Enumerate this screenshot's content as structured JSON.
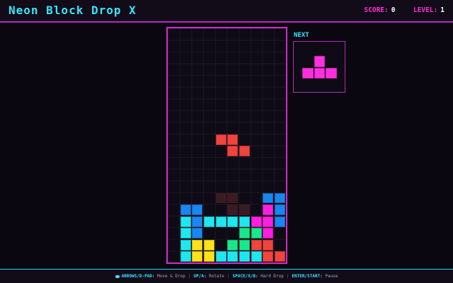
{
  "header": {
    "title": "Neon Block Drop X",
    "title_color": "#35e6ff",
    "score_label": "SCORE:",
    "score": "0",
    "level_label": "LEVEL:",
    "level": "1"
  },
  "next": {
    "label": "NEXT",
    "piece": "T",
    "color": "#ff2fe0",
    "cells": [
      [
        1,
        0
      ],
      [
        0,
        1
      ],
      [
        1,
        1
      ],
      [
        2,
        1
      ]
    ]
  },
  "board": {
    "cols": 10,
    "rows": 20,
    "colors": {
      "blue": "#1a86f0",
      "cyan": "#1fe7f0",
      "magenta": "#ff1fde",
      "green": "#19e88a",
      "yellow": "#ffe21a",
      "red": "#f0443f",
      "ghost": "#3b1b22"
    },
    "active_piece": {
      "type": "Z",
      "color": "red",
      "cells": [
        [
          4,
          9
        ],
        [
          5,
          9
        ],
        [
          5,
          10
        ],
        [
          6,
          10
        ]
      ]
    },
    "ghost_piece": {
      "cells": [
        [
          4,
          14
        ],
        [
          5,
          14
        ],
        [
          5,
          15
        ],
        [
          6,
          15
        ]
      ]
    },
    "locked": [
      {
        "c": 8,
        "r": 14,
        "color": "blue"
      },
      {
        "c": 9,
        "r": 14,
        "color": "blue"
      },
      {
        "c": 1,
        "r": 15,
        "color": "blue"
      },
      {
        "c": 2,
        "r": 15,
        "color": "blue"
      },
      {
        "c": 8,
        "r": 15,
        "color": "magenta"
      },
      {
        "c": 9,
        "r": 15,
        "color": "blue"
      },
      {
        "c": 1,
        "r": 16,
        "color": "cyan"
      },
      {
        "c": 2,
        "r": 16,
        "color": "blue"
      },
      {
        "c": 3,
        "r": 16,
        "color": "cyan"
      },
      {
        "c": 4,
        "r": 16,
        "color": "cyan"
      },
      {
        "c": 5,
        "r": 16,
        "color": "cyan"
      },
      {
        "c": 6,
        "r": 16,
        "color": "cyan"
      },
      {
        "c": 7,
        "r": 16,
        "color": "magenta"
      },
      {
        "c": 8,
        "r": 16,
        "color": "magenta"
      },
      {
        "c": 9,
        "r": 16,
        "color": "blue"
      },
      {
        "c": 1,
        "r": 17,
        "color": "cyan"
      },
      {
        "c": 2,
        "r": 17,
        "color": "blue"
      },
      {
        "c": 6,
        "r": 17,
        "color": "green"
      },
      {
        "c": 7,
        "r": 17,
        "color": "green"
      },
      {
        "c": 8,
        "r": 17,
        "color": "magenta"
      },
      {
        "c": 1,
        "r": 18,
        "color": "cyan"
      },
      {
        "c": 2,
        "r": 18,
        "color": "yellow"
      },
      {
        "c": 3,
        "r": 18,
        "color": "yellow"
      },
      {
        "c": 5,
        "r": 18,
        "color": "green"
      },
      {
        "c": 6,
        "r": 18,
        "color": "green"
      },
      {
        "c": 7,
        "r": 18,
        "color": "red"
      },
      {
        "c": 8,
        "r": 18,
        "color": "red"
      },
      {
        "c": 1,
        "r": 19,
        "color": "cyan"
      },
      {
        "c": 2,
        "r": 19,
        "color": "yellow"
      },
      {
        "c": 3,
        "r": 19,
        "color": "yellow"
      },
      {
        "c": 4,
        "r": 19,
        "color": "cyan"
      },
      {
        "c": 5,
        "r": 19,
        "color": "cyan"
      },
      {
        "c": 6,
        "r": 19,
        "color": "cyan"
      },
      {
        "c": 7,
        "r": 19,
        "color": "cyan"
      },
      {
        "c": 8,
        "r": 19,
        "color": "red"
      },
      {
        "c": 9,
        "r": 19,
        "color": "red"
      }
    ]
  },
  "footer": {
    "controls": [
      {
        "key": "ARROWS/D-PAD:",
        "desc": "Move & Drop"
      },
      {
        "key": "UP/A:",
        "desc": "Rotate"
      },
      {
        "key": "SPACE/X/B:",
        "desc": "Hard Drop"
      },
      {
        "key": "ENTER/START:",
        "desc": "Pause"
      }
    ]
  }
}
